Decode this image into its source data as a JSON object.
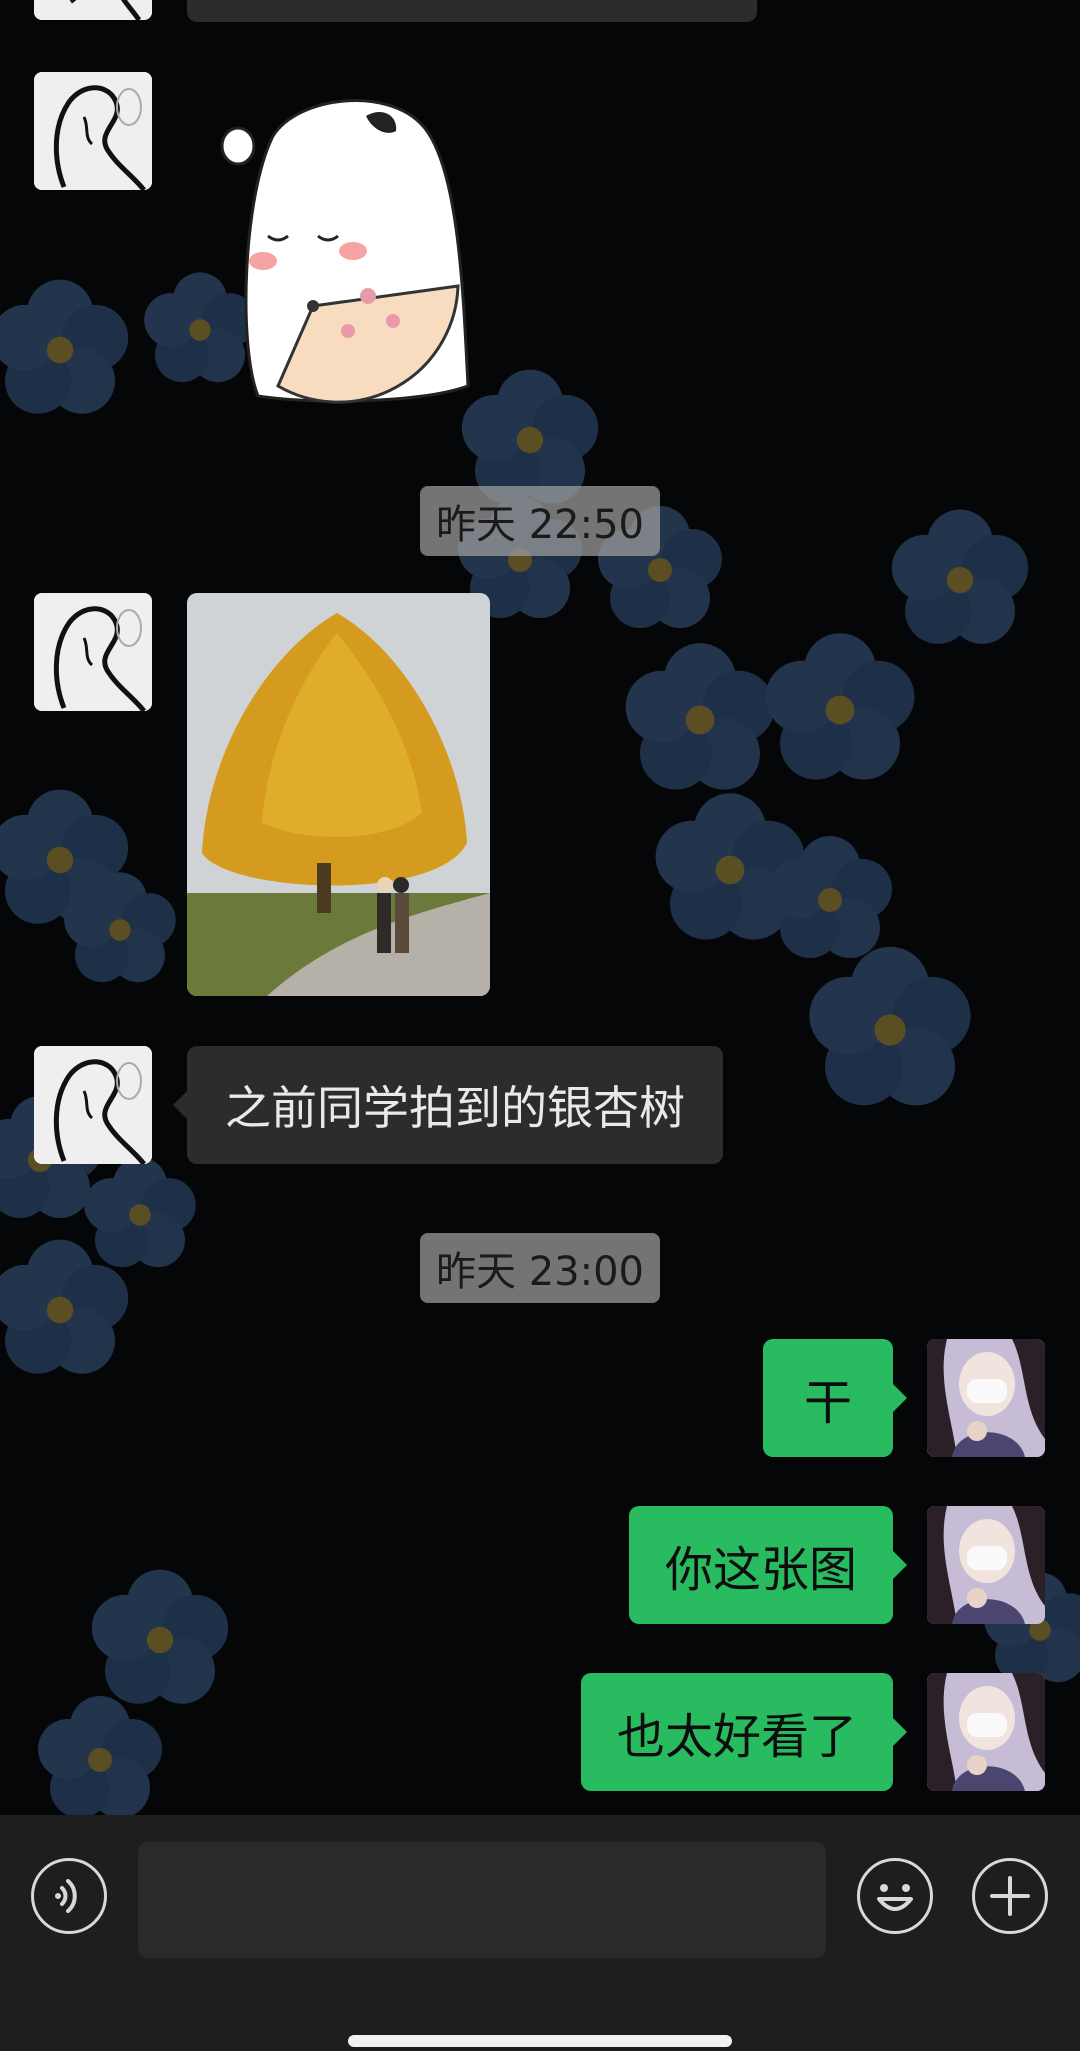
{
  "chat": {
    "timestamps": [
      "昨天 22:50",
      "昨天 23:00"
    ],
    "peer_messages": [
      {
        "type": "text",
        "text": "之前同学拍到的银杏树"
      }
    ],
    "self_messages": [
      {
        "text": "干"
      },
      {
        "text": "你这张图"
      },
      {
        "text": "也太好看了"
      }
    ]
  },
  "input_bar": {
    "voice_icon": "voice-icon",
    "emoji_icon": "emoji-icon",
    "plus_icon": "plus-icon"
  },
  "colors": {
    "self_bubble": "#29bb60",
    "peer_bubble": "#2c2c2c",
    "input_bar": "#1e1e1e"
  }
}
